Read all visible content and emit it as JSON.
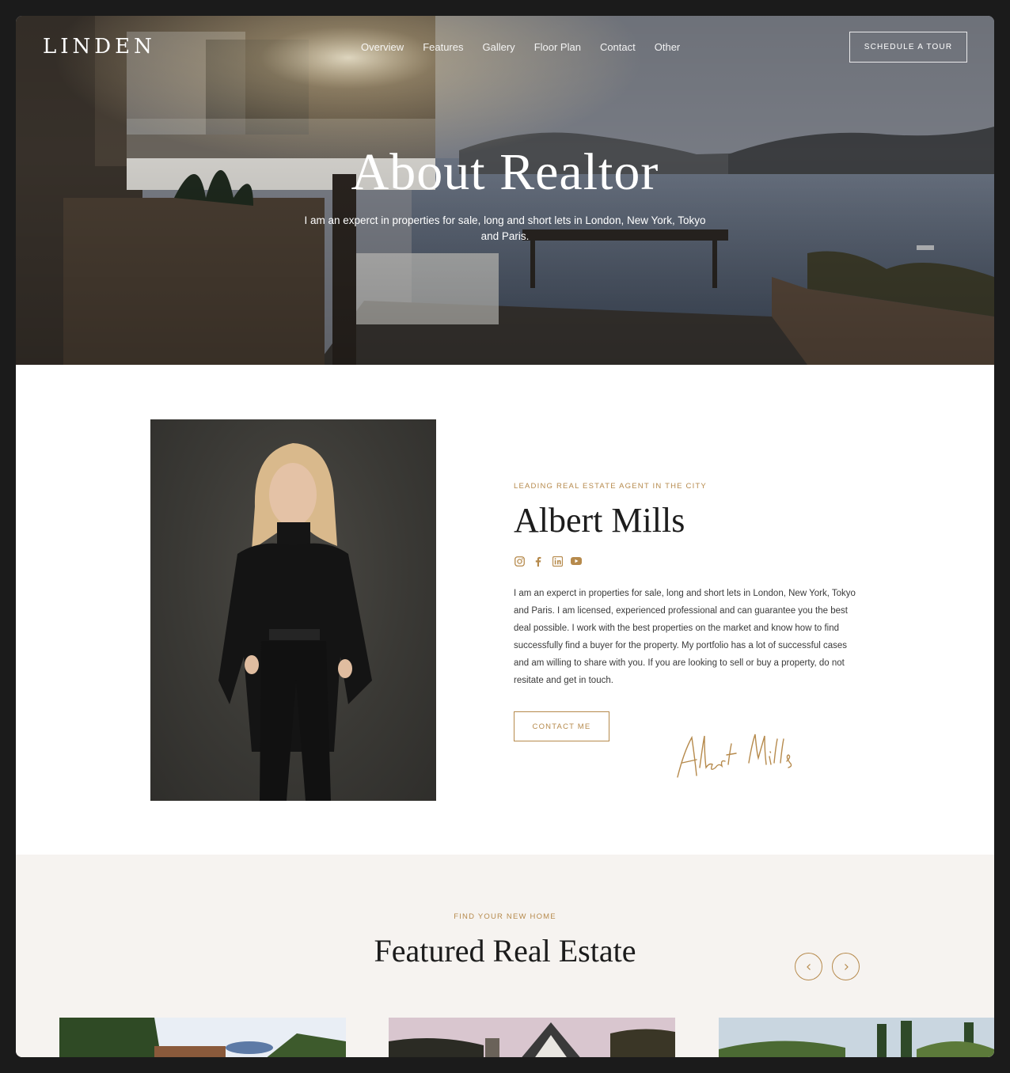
{
  "brand": {
    "logo": "LINDEN",
    "accent": "#b68a4c"
  },
  "nav": {
    "items": [
      "Overview",
      "Features",
      "Gallery",
      "Floor Plan",
      "Contact",
      "Other"
    ]
  },
  "header": {
    "cta_label": "SCHEDULE A TOUR"
  },
  "hero": {
    "title": "About Realtor",
    "subtitle": "I am an experct in properties for sale, long and short lets in London, New York, Tokyo and Paris."
  },
  "about": {
    "eyebrow": "LEADING REAL ESTATE AGENT IN THE CITY",
    "name": "Albert Mills",
    "socials": [
      "instagram-icon",
      "facebook-icon",
      "linkedin-icon",
      "youtube-icon"
    ],
    "bio": "I am an experct in properties for sale, long and short lets in London, New York, Tokyo and Paris. I am licensed, experienced professional and can guarantee you the best deal possible. I work with the best properties on the market and know how to find successfully find a buyer for the property. My portfolio has a lot of successful cases and am willing to share with you. If you are looking to sell or buy a property, do not resitate and get in touch.",
    "contact_label": "CONTACT ME",
    "signature": "Albert Mills"
  },
  "featured": {
    "eyebrow": "FIND YOUR NEW HOME",
    "title": "Featured Real Estate",
    "prev_icon": "chevron-left-icon",
    "next_icon": "chevron-right-icon"
  }
}
